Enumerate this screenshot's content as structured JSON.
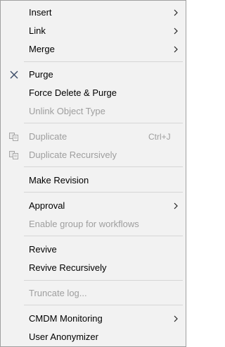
{
  "menu": {
    "insert": "Insert",
    "link": "Link",
    "merge": "Merge",
    "purge": "Purge",
    "force_delete_purge": "Force Delete & Purge",
    "unlink_object_type": "Unlink Object Type",
    "duplicate": "Duplicate",
    "duplicate_shortcut": "Ctrl+J",
    "duplicate_recursively": "Duplicate Recursively",
    "make_revision": "Make Revision",
    "approval": "Approval",
    "enable_group_workflows": "Enable group for workflows",
    "revive": "Revive",
    "revive_recursively": "Revive Recursively",
    "truncate_log": "Truncate log...",
    "cmdm_monitoring": "CMDM Monitoring",
    "user_anonymizer": "User Anonymizer"
  },
  "icons": {
    "submenu": "chevron-right-icon",
    "purge": "cross-icon",
    "duplicate": "copy-document-icon"
  },
  "colors": {
    "menu_background": "#f2f2f2",
    "text": "#000000",
    "disabled_text": "#9e9e9e",
    "separator": "#d6d6d6"
  }
}
